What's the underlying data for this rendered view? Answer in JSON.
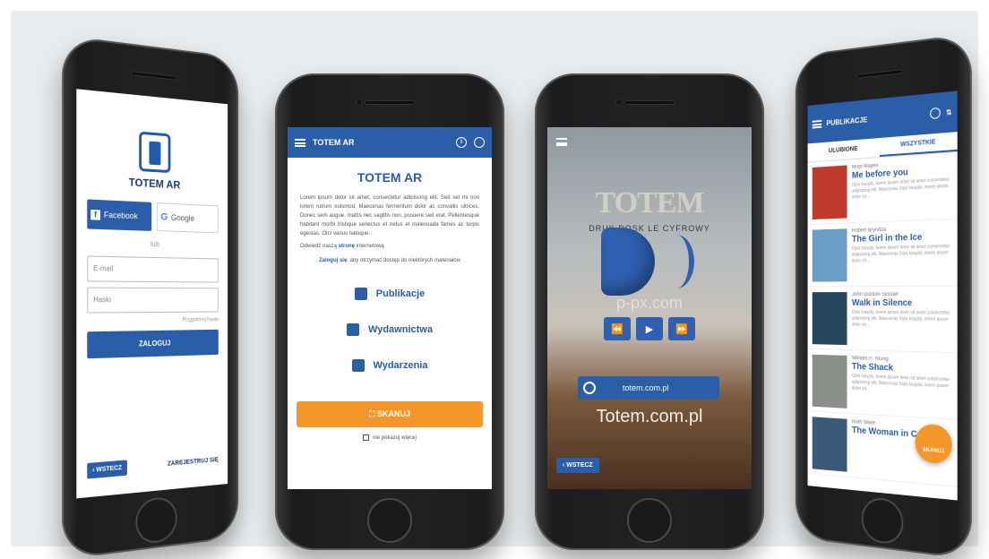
{
  "login": {
    "brand": "TOTEM AR",
    "facebook_label": "Facebook",
    "google_label": "Google",
    "divider": "lub",
    "email_placeholder": "E-mail",
    "password_placeholder": "Hasło",
    "forgot": "Przypomnij hasło",
    "login_button": "ZALOGUJ",
    "back_button": "WSTECZ",
    "register_link": "ZAREJESTRUJ SIĘ"
  },
  "home": {
    "app_title": "TOTEM AR",
    "heading": "TOTEM AR",
    "body": "Lorem ipsum dolor sit amet, consectetur adipiscing elit. Sed vel mi non lorem rutrum euismod. Maecenas fermentum dolor ac convallis ultrices. Donec sem augue, mattis nec sagittis non, posuere sed erat. Pellentesque habitant morbi tristique senectus et netus et malesuada fames ac turpis egestas. Orci varius natoque.",
    "visit_prefix": "Odwiedź naszą",
    "visit_link": "stronę",
    "visit_suffix": "internetową",
    "login_link": "Zaloguj się",
    "login_note": ", aby otrzymać dostęp do niektórych materiałów",
    "menu": [
      {
        "label": "Publikacje",
        "icon": "book-open-icon"
      },
      {
        "label": "Wydawnictwa",
        "icon": "book-icon"
      },
      {
        "label": "Wydarzenia",
        "icon": "calendar-icon"
      }
    ],
    "scan_button": "SKANUJ",
    "dont_show": "nie pokazuj więcej"
  },
  "player": {
    "logo_text": "TOTEM",
    "subtitle": "DRUK DOSK    LE CYFROWY",
    "watermark": "p-px.com",
    "url_button": "totem.com.pl",
    "url_overlay": "Totem.com.pl",
    "back_button": "WSTECZ",
    "controls": [
      "⏪",
      "▶",
      "⏩"
    ]
  },
  "publications": {
    "title": "PUBLIKACJE",
    "tabs": [
      "ULUBIONE",
      "WSZYSTKIE"
    ],
    "active_tab": "WSZYSTKIE",
    "desc": "Opis książki, lorem ipsum dolor sit amet consectetur adipiscing elit. Maecenas Opis książki, lorem ipsum dolor sit...",
    "books": [
      {
        "author": "Mojo Mayes",
        "title": "Me before you",
        "cover": "#c0392b"
      },
      {
        "author": "Robert Bryndza",
        "title": "The Girl in the Ice",
        "cover": "#6a9ec8"
      },
      {
        "author": "John Gordon Sinclair",
        "title": "Walk in Silence",
        "cover": "#27475e"
      },
      {
        "author": "William P. Young",
        "title": "The Shack",
        "cover": "#8a8f8a"
      },
      {
        "author": "Ruth Ware",
        "title": "The Woman in Cabin...",
        "cover": "#3b5a7a"
      }
    ],
    "fab_label": "SKANUJ"
  }
}
